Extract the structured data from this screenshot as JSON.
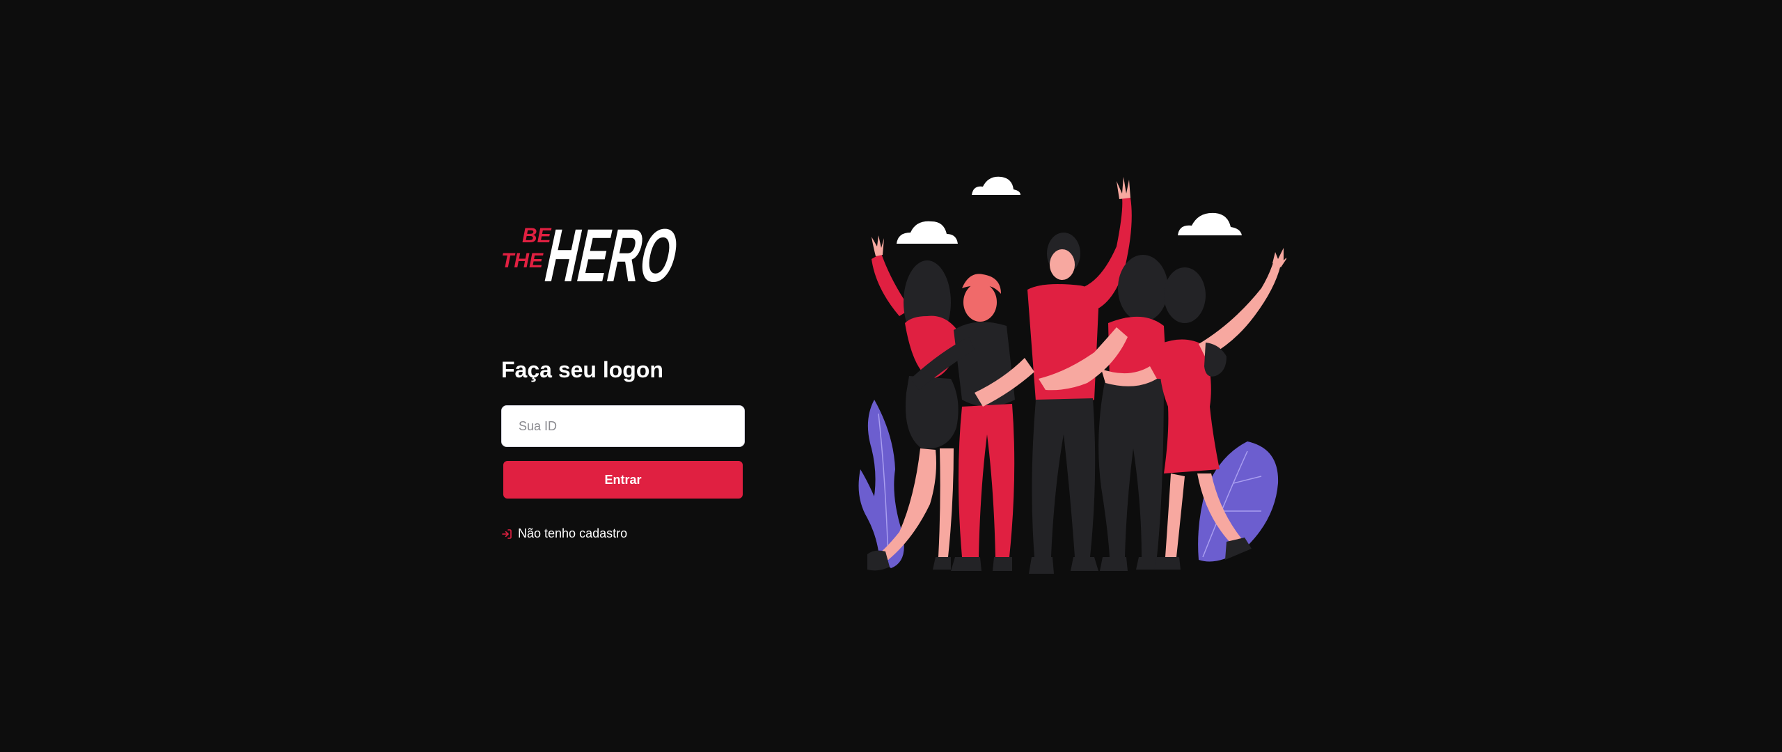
{
  "logo": {
    "text_small_1": "BE",
    "text_small_2": "THE",
    "text_big": "HERO"
  },
  "logon": {
    "title": "Faça seu logon",
    "id_placeholder": "Sua ID",
    "submit_label": "Entrar",
    "register_link": "Não tenho cadastro"
  },
  "icons": {
    "register": "log-in-icon"
  },
  "colors": {
    "background": "#0d0d0d",
    "accent": "#e02041",
    "illustration_purple": "#6c5ecf",
    "illustration_dark": "#232326",
    "illustration_skin": "#f7a8a0"
  }
}
